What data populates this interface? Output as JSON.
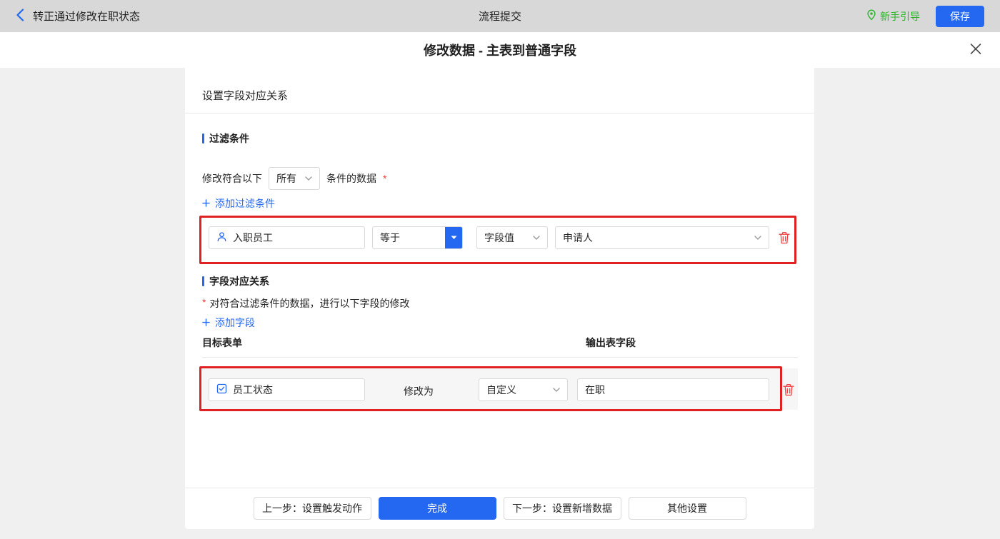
{
  "colors": {
    "accent": "#2468f2",
    "danger": "#f03e3e",
    "annotation": "#e02121",
    "guide_green": "#2bb32b",
    "topbar_bg": "#d8d8d8"
  },
  "topbar": {
    "title": "转正通过修改在职状态",
    "center_title": "流程提交",
    "guide": "新手引导",
    "save": "保存"
  },
  "modal": {
    "title": "修改数据 - 主表到普通字段"
  },
  "panel": {
    "header": "设置字段对应关系",
    "filter": {
      "heading": "过滤条件",
      "cond_prefix": "修改符合以下",
      "cond_select": "所有",
      "cond_suffix": "条件的数据",
      "required": "*",
      "add_link": "添加过滤条件",
      "row": {
        "field": "入职员工",
        "operator": "等于",
        "value_type": "字段值",
        "value": "申请人"
      }
    },
    "mapping": {
      "heading": "字段对应关系",
      "required": "*",
      "desc": "对符合过滤条件的数据，进行以下字段的修改",
      "add_link": "添加字段",
      "col_target": "目标表单",
      "col_output": "输出表字段",
      "row": {
        "field": "员工状态",
        "action_label": "修改为",
        "mode": "自定义",
        "value": "在职"
      }
    },
    "footer": {
      "prev": "上一步：设置触发动作",
      "done": "完成",
      "next": "下一步：设置新增数据",
      "other": "其他设置"
    }
  }
}
